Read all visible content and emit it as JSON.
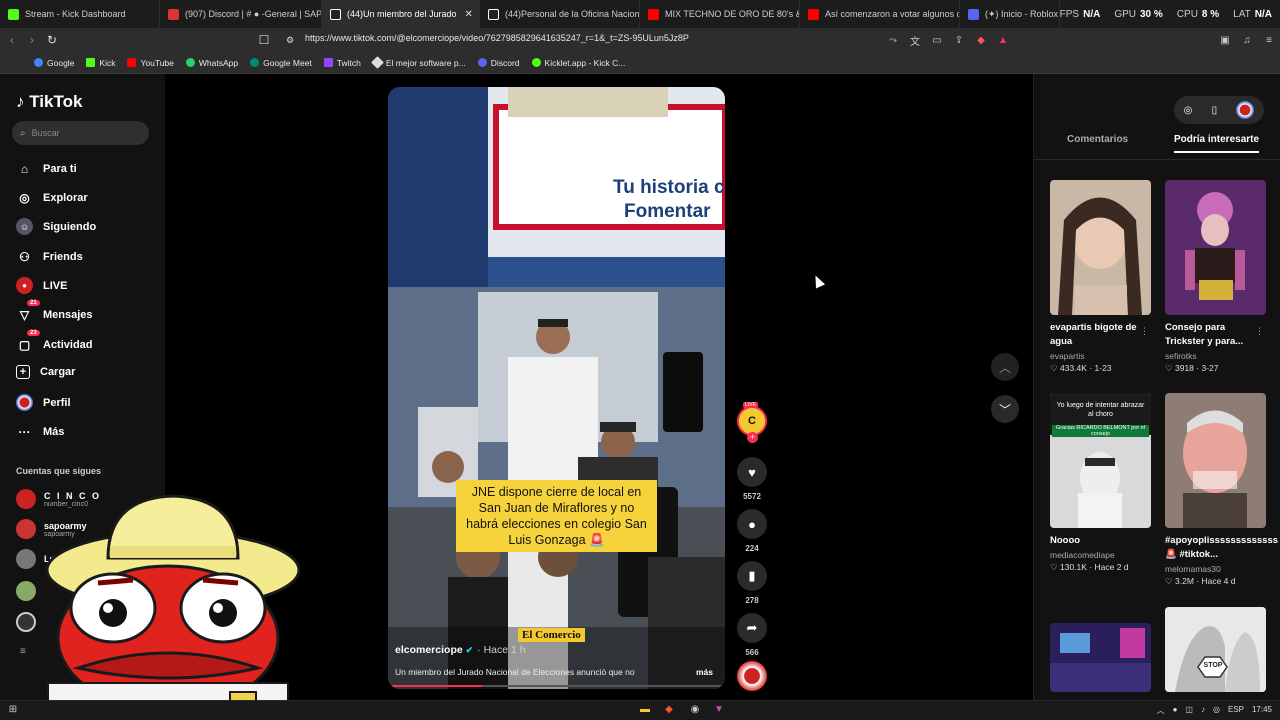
{
  "browser": {
    "tabs": [
      {
        "label": "Stream - Kick Dashboard",
        "color": "#53fc18"
      },
      {
        "label": "(907) Discord | # ● -General | SAPO...",
        "color": "#d33"
      },
      {
        "label": "(44)Un miembro del Jurado",
        "color": "#fff",
        "active": true
      },
      {
        "label": "(44)Personal de la Oficina Nacional",
        "color": "#fff"
      },
      {
        "label": "MIX TECHNO DE ORO DE 80's & 90's",
        "color": "#f00"
      },
      {
        "label": "Así comenzaron a votar algunos ca...",
        "color": "#f00"
      },
      {
        "label": "(✦) Inicio - Roblox",
        "color": "#5865f2"
      }
    ],
    "perf": {
      "fps_label": "FPS",
      "fps": "N/A",
      "gpu_label": "GPU",
      "gpu": "30 %",
      "cpu_label": "CPU",
      "cpu": "8 %",
      "lat_label": "LAT",
      "lat": "N/A"
    },
    "url": "https://www.tiktok.com/@elcomerciope/video/7627985829641635247_r=1&_t=ZS-95ULun5Jz8P",
    "bookmarks": [
      {
        "label": "Google",
        "color": "#4285f4"
      },
      {
        "label": "Kick",
        "color": "#53fc18"
      },
      {
        "label": "YouTube",
        "color": "#ff0000"
      },
      {
        "label": "WhatsApp",
        "color": "#25d366"
      },
      {
        "label": "Google Meet",
        "color": "#00897b"
      },
      {
        "label": "Twitch",
        "color": "#9146ff"
      },
      {
        "label": "El mejor software p...",
        "color": "#dddddd"
      },
      {
        "label": "Discord",
        "color": "#5865f2"
      },
      {
        "label": "Kicklet.app - Kick C...",
        "color": "#53fc18"
      }
    ]
  },
  "tiktok": {
    "logo": "TikTok",
    "search_placeholder": "Buscar",
    "nav": [
      {
        "label": "Para ti",
        "icon": "home-icon"
      },
      {
        "label": "Explorar",
        "icon": "compass-icon"
      },
      {
        "label": "Siguiendo",
        "icon": "following-icon"
      },
      {
        "label": "Friends",
        "icon": "friends-icon"
      },
      {
        "label": "LIVE",
        "icon": "live-icon"
      },
      {
        "label": "Mensajes",
        "icon": "messages-icon",
        "badge": "21"
      },
      {
        "label": "Actividad",
        "icon": "activity-icon",
        "badge": "23"
      },
      {
        "label": "Cargar",
        "icon": "upload-icon"
      },
      {
        "label": "Perfil",
        "icon": "profile-icon"
      },
      {
        "label": "Más",
        "icon": "more-icon"
      }
    ],
    "following_header": "Cuentas que sigues",
    "following": [
      {
        "name": "C I N C O",
        "handle": "number_cinc0",
        "color": "#c22"
      },
      {
        "name": "sapoarmy",
        "handle": "sapoarmy",
        "color": "#c33"
      },
      {
        "name": "Luci",
        "handle": "",
        "color": "#777"
      },
      {
        "name": "",
        "handle": "",
        "color": "#8a6"
      },
      {
        "name": "",
        "handle": "",
        "color": "#ccc"
      }
    ],
    "video": {
      "banner_line1": "Tu historia co",
      "banner_line2": "Fomentar",
      "caption": "JNE dispone cierre de local en San Juan de Miraflores y no habrá elecciones en colegio San Luis Gonzaga 🚨",
      "brand": "El Comercio",
      "author": "elcomerciope",
      "age": "· Hace 1 h",
      "description": "Un miembro del Jurado Nacional de Elecciones anunció que no",
      "more": "más",
      "progress": 0.28
    },
    "actions": {
      "live_label": "LIVE",
      "likes": "5572",
      "comments": "224",
      "saves": "278",
      "shares": "566"
    },
    "right": {
      "tabs": [
        "Comentarios",
        "Podría interesarte"
      ],
      "cards": [
        {
          "title": "evapartis bigote de agua",
          "author": "evapartis",
          "likes": "433.4K",
          "date": "1-23"
        },
        {
          "title": "Consejo para Trickster y para...",
          "author": "sefirotks",
          "likes": "3918",
          "date": "3-27"
        },
        {
          "title": "Noooo",
          "author": "mediacomediape",
          "likes": "130.1K",
          "date": "Hace 2 d",
          "overlay_top": "Yo luego de intentar abrazar al choro",
          "overlay_mid": "Gracias RICARDO BELMONT por el consejo"
        },
        {
          "title": "#apoyoplisssssssssssss 🚨 #tiktok...",
          "author": "melomamas30",
          "likes": "3.2M",
          "date": "Hace 4 d"
        },
        {
          "title": "",
          "author": "",
          "likes": "",
          "date": ""
        },
        {
          "title": "",
          "author": "",
          "likes": "",
          "date": ""
        }
      ],
      "card6_text": "STOP"
    }
  },
  "taskbar": {
    "lang": "ESP",
    "time": "17:45"
  }
}
